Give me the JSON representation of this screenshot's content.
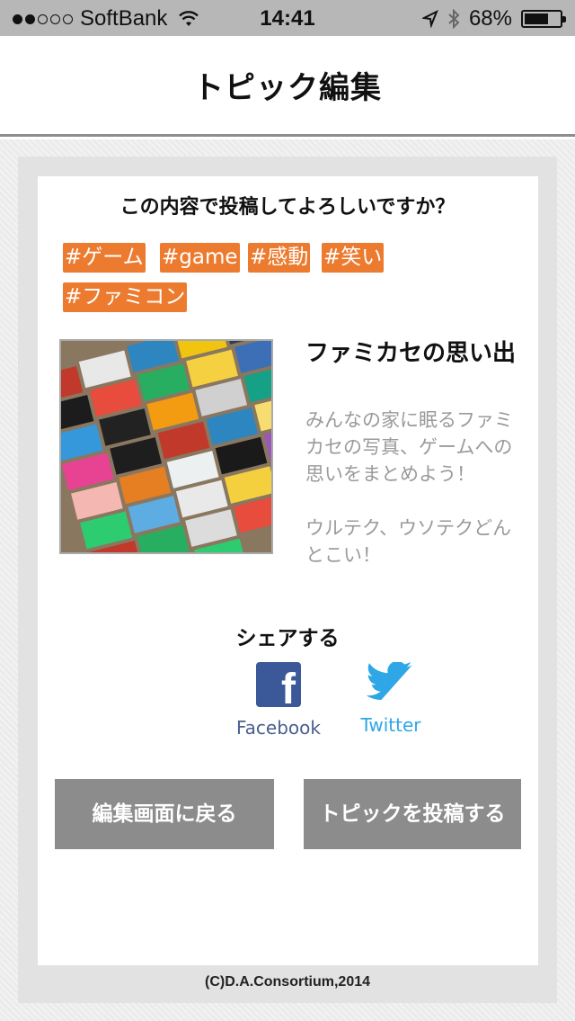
{
  "status_bar": {
    "carrier": "SoftBank",
    "time": "14:41",
    "battery": "68%",
    "battery_level": 0.68,
    "signal_bars_filled": 2,
    "signal_bars_total": 5
  },
  "nav": {
    "title": "トピック編集"
  },
  "confirm": {
    "question": "この内容で投稿してよろしいですか？"
  },
  "tags": [
    "#ゲーム",
    "#game",
    "#感動",
    "#笑い",
    "#ファミコン"
  ],
  "topic": {
    "title": "ファミカセの思い出",
    "description": "みんなの家に眠るファミカセの写真、ゲームへの思いをまとめよう！\n\nウルテク、ウソテクどんとこい！"
  },
  "share": {
    "label": "シェアする",
    "facebook_label": "Facebook",
    "twitter_label": "Twitter",
    "facebook_icon": "facebook-icon",
    "twitter_icon": "twitter-icon"
  },
  "buttons": {
    "back_label": "編集画面に戻る",
    "post_label": "トピックを投稿する"
  },
  "footer": {
    "copyright": "(C)D.A.Consortium,2014"
  },
  "colors": {
    "tag_bg": "#ec7b2f",
    "button_bg": "#8c8c8c",
    "facebook": "#3b5998",
    "twitter": "#2fa6e6"
  }
}
